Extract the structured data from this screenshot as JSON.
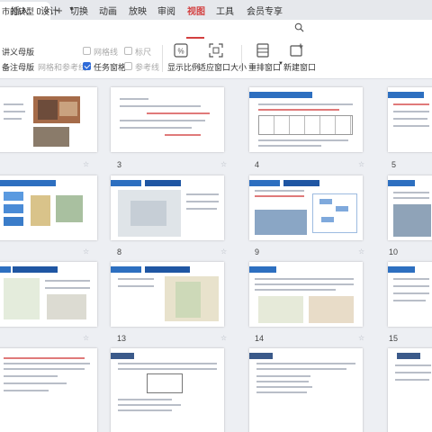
{
  "doc_tab": {
    "title": "市的转型"
  },
  "menu": [
    "插入",
    "设计",
    "切换",
    "动画",
    "放映",
    "审阅",
    "视图",
    "工具",
    "会员专享"
  ],
  "menu_active": "视图",
  "ribbon": {
    "handout_master": "讲义母版",
    "notes_master": "备注母版",
    "gridlines": "网格线",
    "ruler": "标尺",
    "grid_and_guides": "网格和参考线",
    "task_pane": "任务窗格",
    "guides": "参考线",
    "show_ratio": "显示比例",
    "fit_window": "适应窗口大小",
    "rearrange_windows": "重排窗口",
    "new_window": "新建窗口"
  },
  "checkboxes": {
    "gridlines": false,
    "ruler": false,
    "task_pane": true,
    "guides": false
  },
  "slide_numbers": [
    "3",
    "4",
    "5",
    "8",
    "9",
    "10",
    "13",
    "14",
    "15"
  ],
  "colors": {
    "accent": "#d33f3f",
    "header_blue": "#2d6fc0",
    "checkbox_blue": "#2f6bd8"
  }
}
